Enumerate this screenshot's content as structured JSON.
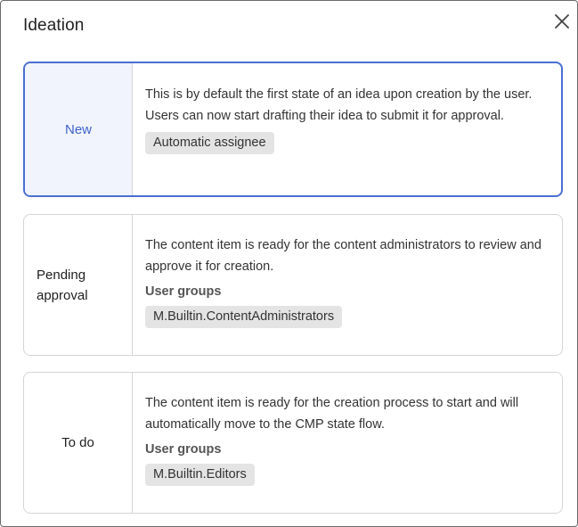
{
  "dialog": {
    "title": "Ideation",
    "close_icon": "close-icon"
  },
  "states": [
    {
      "name": "New",
      "selected": true,
      "description": "This is by default the first state of an idea upon creation by the user. Users can now start drafting their idea to submit it for approval.",
      "section_label": "",
      "chip": "Automatic assignee"
    },
    {
      "name": "Pending approval",
      "selected": false,
      "description": "The content item is ready for the content administrators to review and approve it for creation.",
      "section_label": "User groups",
      "chip": "M.Builtin.ContentAdministrators"
    },
    {
      "name": "To do",
      "selected": false,
      "description": "The content item is ready for the creation process to start and will automatically move to the CMP state flow.",
      "section_label": "User groups",
      "chip": "M.Builtin.Editors"
    }
  ],
  "colors": {
    "accent": "#4a6fd1",
    "selected_bg": "#f1f4fd",
    "chip_bg": "#e4e4e4",
    "border": "#d5d5d5"
  }
}
